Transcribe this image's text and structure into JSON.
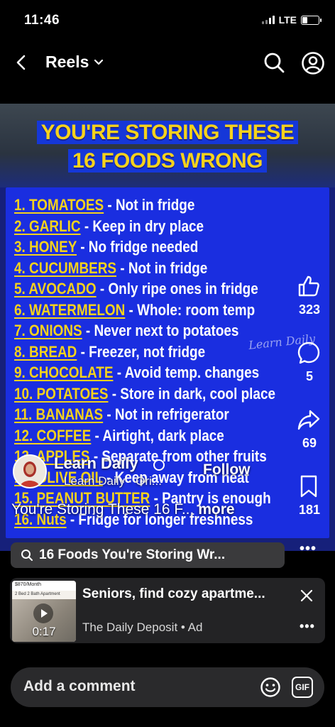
{
  "status": {
    "time": "11:46",
    "network": "LTE"
  },
  "header": {
    "title": "Reels"
  },
  "video": {
    "headline_line1": "YOU'RE STORING THESE",
    "headline_line2": "16 FOODS WRONG",
    "items": [
      {
        "num": "1. TOMATOES",
        "desc": " - Not in fridge"
      },
      {
        "num": "2. GARLIC",
        "desc": " - Keep in dry place"
      },
      {
        "num": "3. HONEY",
        "desc": " - No fridge needed"
      },
      {
        "num": "4. CUCUMBERS",
        "desc": " - Not in fridge"
      },
      {
        "num": "5. AVOCADO",
        "desc": " - Only ripe ones in fridge"
      },
      {
        "num": "6. WATERMELON",
        "desc": " - Whole: room temp"
      },
      {
        "num": "7. ONIONS",
        "desc": " - Never next to potatoes"
      },
      {
        "num": "8. BREAD",
        "desc": " - Freezer, not fridge"
      },
      {
        "num": "9. CHOCOLATE",
        "desc": " - Avoid temp. changes"
      },
      {
        "num": "10. POTATOES",
        "desc": " - Store in dark, cool place"
      },
      {
        "num": "11. BANANAS",
        "desc": " - Not in refrigerator"
      },
      {
        "num": "12. COFFEE",
        "desc": " - Airtight, dark place"
      },
      {
        "num": "13. APPLES",
        "desc": " - Separate from other fruits"
      },
      {
        "num": "14. OLIVE OIL",
        "desc": " - Keep away from heat"
      },
      {
        "num": "15. PEANUT BUTTER",
        "desc": " - Pantry is enough"
      },
      {
        "num": "16. Nuts",
        "desc": " - Fridge for longer freshness"
      }
    ],
    "watermark": "Learn Daily"
  },
  "rail": {
    "likes": "323",
    "comments": "5",
    "shares": "69",
    "saves": "181"
  },
  "creator": {
    "name": "Learn Daily",
    "sub": "Learn Daily · Ori...",
    "follow": "Follow"
  },
  "caption": {
    "text": "You're Storing These 16 F...",
    "more": "more"
  },
  "search_chip": {
    "text": "16 Foods You're Storing Wr..."
  },
  "ad": {
    "title": "Seniors, find cozy apartme...",
    "sponsor": "The Daily Deposit",
    "label": "Ad",
    "duration": "0:17",
    "thumb_price": "$870/Month",
    "thumb_caption": "2 Bed 2 Bath Apartment"
  },
  "comment_bar": {
    "placeholder": "Add a comment",
    "gif": "GIF"
  }
}
